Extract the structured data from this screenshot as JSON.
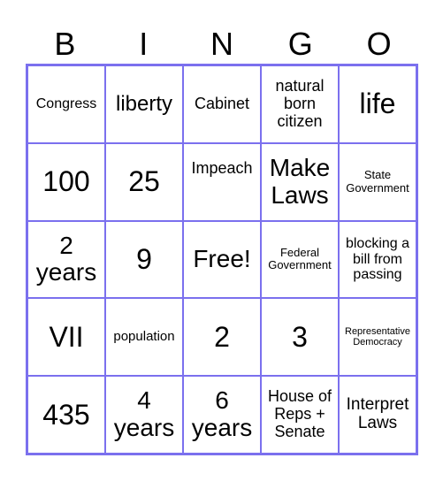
{
  "header": {
    "letters": [
      "B",
      "I",
      "N",
      "G",
      "O"
    ]
  },
  "theme": {
    "border_color": "#7b70ee",
    "text_color": "#000000",
    "background": "#ffffff"
  },
  "cells": [
    "Congress",
    "liberty",
    "Cabinet",
    "natural born citizen",
    "life",
    "100",
    "25",
    "Impeach",
    "Make Laws",
    "State Government",
    "2 years",
    "9",
    "Free!",
    "Federal Government",
    "blocking a bill from passing",
    "VII",
    "population",
    "2",
    "3",
    "Representative Democracy",
    "435",
    "4 years",
    "6 years",
    "House of Reps + Senate",
    "Interpret Laws"
  ]
}
